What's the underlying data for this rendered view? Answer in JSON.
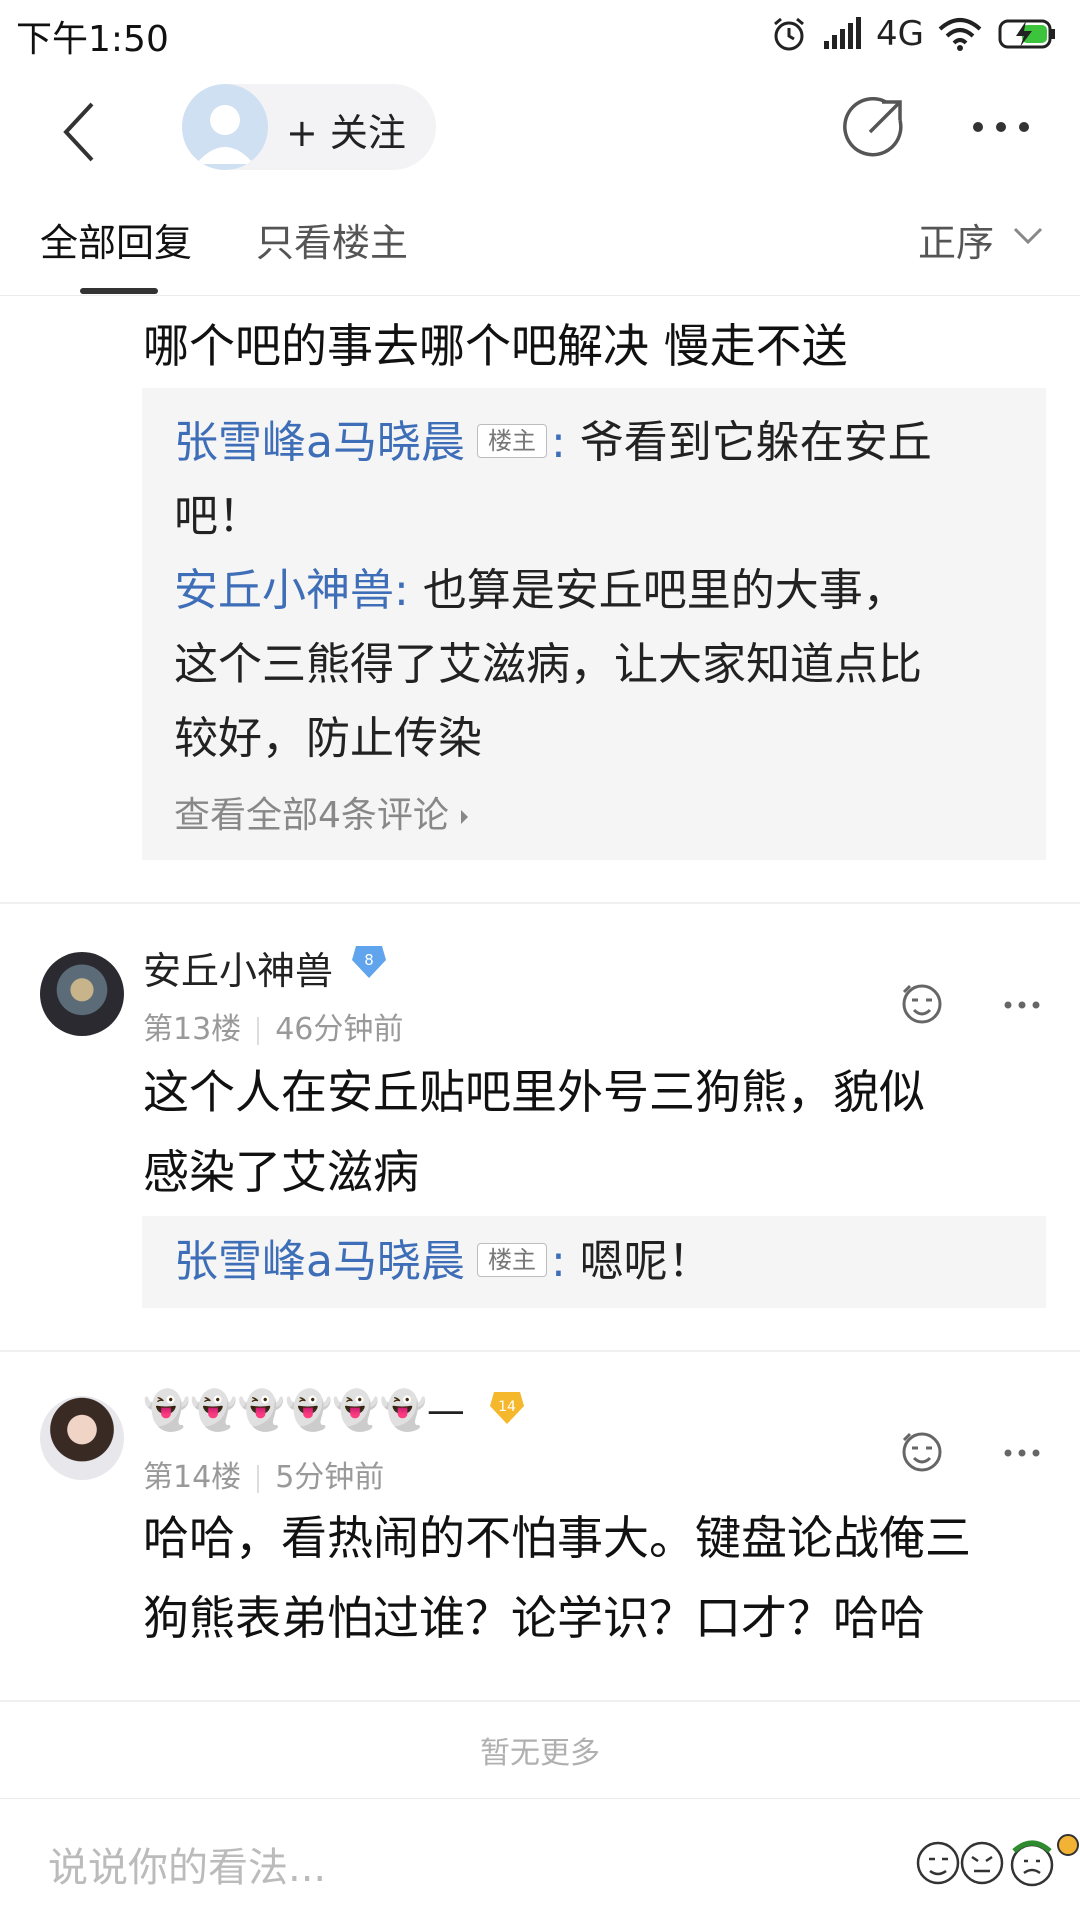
{
  "status_bar": {
    "time": "下午1:50",
    "network": "4G",
    "icons": [
      "alarm-icon",
      "signal-icon",
      "wifi-icon",
      "battery-charging-icon"
    ]
  },
  "nav": {
    "follow_label": "+ 关注",
    "icons": [
      "back-icon",
      "share-icon",
      "more-icon"
    ]
  },
  "tabs": {
    "all": "全部回复",
    "op_only": "只看楼主",
    "sort": "正序"
  },
  "post_top": {
    "content": "哪个吧的事去哪个吧解决 慢走不送",
    "replies": [
      {
        "user": "张雪峰a马晓晨",
        "badge": "楼主",
        "line1": "爷看到它躲在安丘",
        "line2": "吧！"
      },
      {
        "user": "安丘小神兽",
        "line1": "也算是安丘吧里的大事，",
        "line2": "这个三熊得了艾滋病，让大家知道点比",
        "line3": "较好，防止传染"
      }
    ],
    "view_all": "查看全部4条评论"
  },
  "post_13": {
    "username": "安丘小神兽",
    "level": "8",
    "floor": "第13楼",
    "time": "46分钟前",
    "content_line1": "这个人在安丘贴吧里外号三狗熊，貌似",
    "content_line2": "感染了艾滋病",
    "reply": {
      "user": "张雪峰a马晓晨",
      "badge": "楼主",
      "text": "嗯呢！"
    }
  },
  "post_14": {
    "username": "👻👻👻👻👻👻—",
    "level": "14",
    "floor": "第14楼",
    "time": "5分钟前",
    "content_line1": "哈哈，看热闹的不怕事大。键盘论战俺三",
    "content_line2": "狗熊表弟怕过谁？论学识？口才？哈哈"
  },
  "footer_note": "暂无更多",
  "comment_bar": {
    "placeholder": "说说你的看法..."
  },
  "colors": {
    "link_blue": "#3e6eb8",
    "level_8": "#5fa4ec",
    "level_14": "#f5b72b"
  }
}
